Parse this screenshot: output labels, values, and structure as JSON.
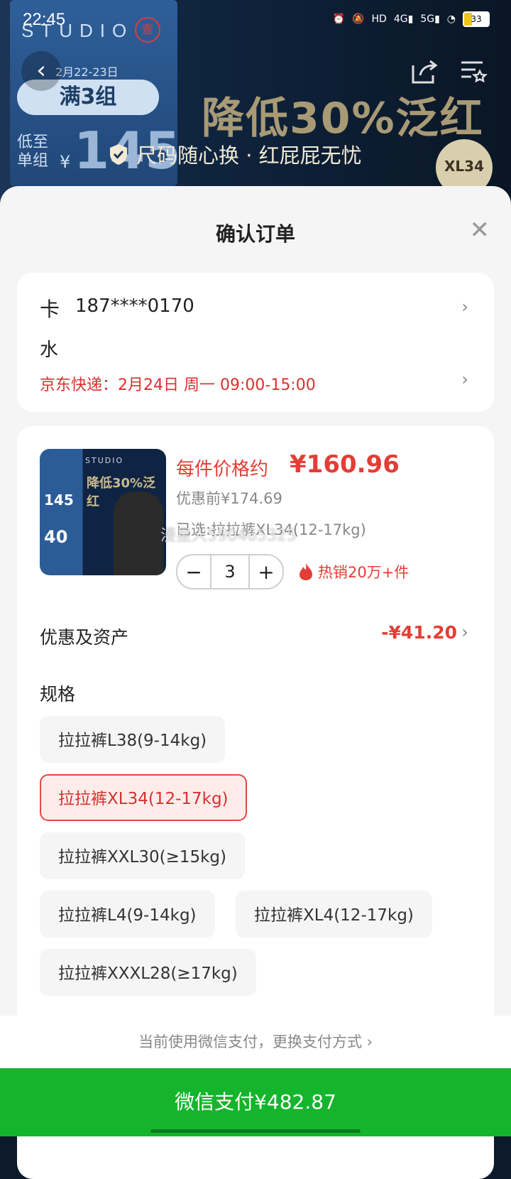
{
  "status_bar": {
    "time": "22:45",
    "battery": "33"
  },
  "banner": {
    "brand": "STUDIO",
    "seal": "壹",
    "date": "2月22-23日",
    "deal_pill": "满3组",
    "low_label_1": "低至",
    "low_label_2": "单组",
    "yen": "¥",
    "low_price": "145",
    "headline": "降低30%泛红",
    "size_badge": "XL34",
    "guarantee": "尺码随心换 · 红屁屁无忧"
  },
  "sheet": {
    "title": "确认订单",
    "address": {
      "name": "卡",
      "phone": "187****0170",
      "address": "水",
      "shipping": "京东快递：2月24日 周一 09:00-15:00"
    },
    "product": {
      "thumb_brand": "STUDIO",
      "thumb_headline": "降低30%泛红",
      "thumb_price": "145",
      "thumb_price2": "40",
      "price_label": "每件价格约",
      "price_value": "¥160.96",
      "before_price": "优惠前¥174.69",
      "selected": "已选:拉拉裤XL34(12-17kg)",
      "quantity": "3",
      "minus": "−",
      "plus": "+",
      "hot_label": "热销20万+件",
      "watermark": "漫星人590465325"
    },
    "discount": {
      "label": "优惠及资产",
      "value": "-¥41.20"
    },
    "spec": {
      "title": "规格",
      "options": [
        "拉拉裤L38(9-14kg)",
        "拉拉裤XL34(12-17kg)",
        "拉拉裤XXL30(≥15kg)",
        "拉拉裤L4(9-14kg)",
        "拉拉裤XL4(12-17kg)",
        "拉拉裤XXXL28(≥17kg)"
      ],
      "selected_index": 1
    },
    "payment_note": "当前使用微信支付，更换支付方式 ›",
    "pay_button": "微信支付¥482.87"
  },
  "colors": {
    "accent_red": "#e43d35",
    "pay_green": "#14b52c"
  }
}
